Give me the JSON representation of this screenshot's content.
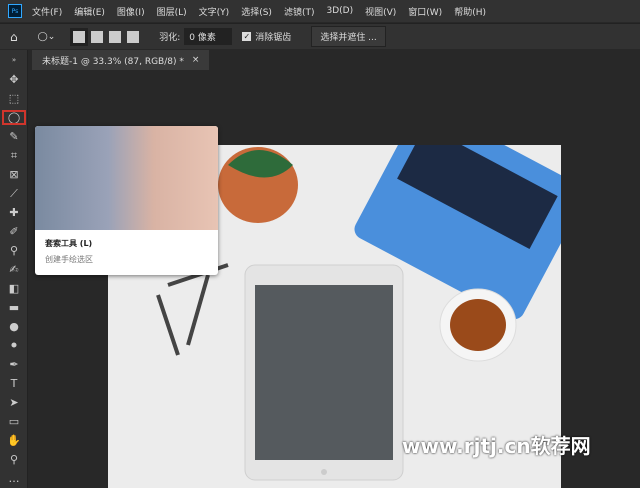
{
  "app": {
    "logo": "Ps"
  },
  "menu": [
    "文件(F)",
    "编辑(E)",
    "图像(I)",
    "图层(L)",
    "文字(Y)",
    "选择(S)",
    "滤镜(T)",
    "3D(D)",
    "视图(V)",
    "窗口(W)",
    "帮助(H)"
  ],
  "options": {
    "feather_label": "羽化:",
    "feather_value": "0 像素",
    "antialias_label": "消除锯齿",
    "antialias_checked": true,
    "select_mask_label": "选择并遮住 ..."
  },
  "document_tab": {
    "title": "未标题-1 @ 33.3% (87, RGB/8) *",
    "close": "×"
  },
  "tools": [
    "move",
    "marquee",
    "lasso",
    "quick-select",
    "crop",
    "frame",
    "eyedropper",
    "healing",
    "brush",
    "stamp",
    "history-brush",
    "eraser",
    "gradient",
    "blur",
    "dodge",
    "pen",
    "type",
    "path-select",
    "rectangle",
    "hand",
    "zoom",
    "more"
  ],
  "active_tool": "lasso",
  "tooltip": {
    "title": "套索工具 (L)",
    "description": "创建手绘选区"
  },
  "watermark": "www.rjtj.cn软荐网",
  "colors": {
    "active_outline": "#d0352c",
    "ui_bg": "#323232",
    "workspace": "#282828"
  }
}
